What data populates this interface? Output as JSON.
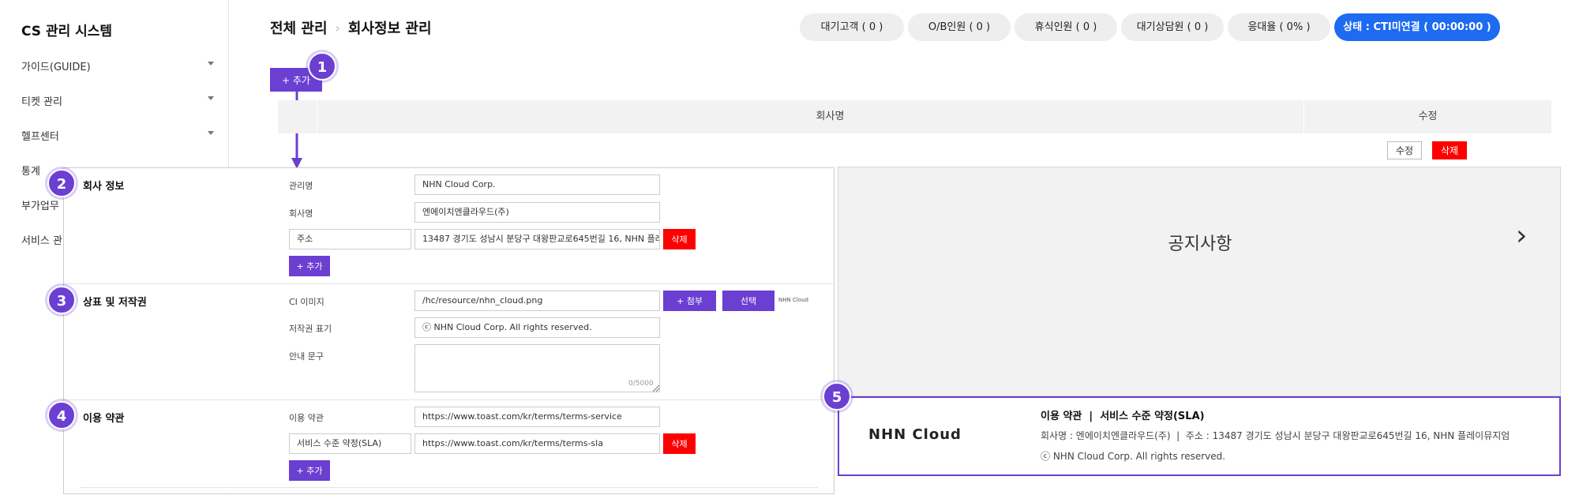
{
  "sidebar": {
    "title": "CS 관리 시스템",
    "items": [
      {
        "label": "가이드(GUIDE)"
      },
      {
        "label": "티켓 관리"
      },
      {
        "label": "헬프센터"
      },
      {
        "label": "통계"
      },
      {
        "label": "부가업무"
      },
      {
        "label": "서비스 관"
      }
    ]
  },
  "header": {
    "breadcrumb": [
      "전체 관리",
      "회사정보 관리"
    ],
    "separator": "›",
    "pills": [
      "대기고객 ( 0 )",
      "O/B인원 ( 0 )",
      "휴식인원 ( 0 )",
      "대기상담원 ( 0 )",
      "응대율 ( 0% )"
    ],
    "status": "상태 : CTI미연결 ( 00:00:00 )"
  },
  "toolbar": {
    "add_label": "+ 추가"
  },
  "table": {
    "columns": [
      "회사명",
      "수정"
    ],
    "edit_label": "수정",
    "delete_label": "삭제"
  },
  "badges": [
    "1",
    "2",
    "3",
    "4",
    "5"
  ],
  "form": {
    "company": {
      "title": "회사 정보",
      "manage_name_label": "관리명",
      "manage_name_value": "NHN Cloud Corp.",
      "company_name_label": "회사명",
      "company_name_value": "엔에이치엔클라우드(주)",
      "address_label": "주소",
      "address_value": "13487 경기도 성남시 분당구 대왕판교로645번길 16, NHN 플레",
      "delete_label": "삭제",
      "add_label": "+ 추가"
    },
    "trademark": {
      "title": "상표 및 저작권",
      "ci_label": "CI 이미지",
      "ci_value": "/hc/resource/nhn_cloud.png",
      "attach_label": "+ 첨부",
      "select_label": "선택",
      "ci_preview": "NHN Cloud",
      "copyright_label": "저작권 표기",
      "copyright_value": "ⓒ NHN Cloud Corp. All rights reserved.",
      "notice_label": "안내 문구",
      "counter": "0/5000"
    },
    "terms": {
      "title": "이용 약관",
      "terms_label": "이용 약관",
      "terms_value": "https://www.toast.com/kr/terms/terms-service",
      "sla_label": "서비스 수준 약정(SLA)",
      "sla_value": "https://www.toast.com/kr/terms/terms-sla",
      "delete_label": "삭제",
      "add_label": "+ 추가"
    }
  },
  "notice": {
    "title": "공지사항",
    "arrow": "›"
  },
  "footer": {
    "logo": "NHN Cloud",
    "links": "이용 약관  |  서비스 수준 약정(SLA)",
    "company_line": "회사명 : 엔에이치엔클라우드(주)  |  주소 : 13487 경기도 성남시 분당구 대왕판교로645번길 16, NHN 플레이뮤지엄",
    "copyright": "ⓒ NHN Cloud Corp. All rights reserved."
  },
  "colors": {
    "accent": "#6a3fd1",
    "status": "#1d6bf0",
    "danger": "#ff0000"
  }
}
